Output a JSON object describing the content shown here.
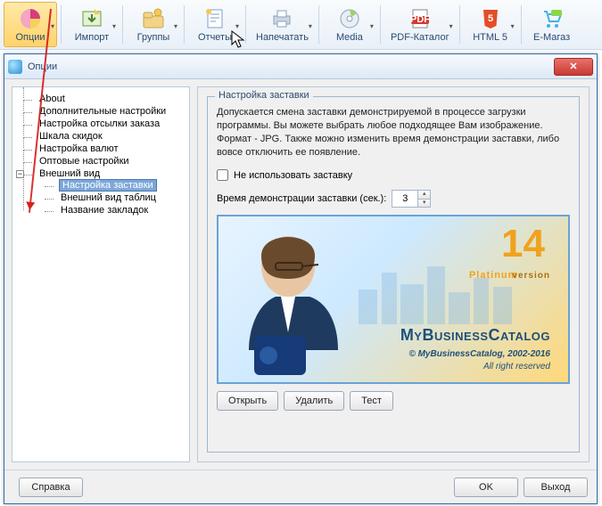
{
  "toolbar": {
    "items": [
      {
        "label": "Опции"
      },
      {
        "label": "Импорт"
      },
      {
        "label": "Группы"
      },
      {
        "label": "Отчеты"
      },
      {
        "label": "Напечатать"
      },
      {
        "label": "Media"
      },
      {
        "label": "PDF-Каталог"
      },
      {
        "label": "HTML 5"
      },
      {
        "label": "E-Магаз"
      }
    ]
  },
  "dialog": {
    "title": "Опции",
    "close": "✕"
  },
  "tree": {
    "items": [
      "About",
      "Дополнительные настройки",
      "Настройка отсылки заказа",
      "Шкала скидок",
      "Настройка валют",
      "Оптовые настройки"
    ],
    "group_label": "Внешний вид",
    "group_expander": "−",
    "children": [
      "Настройка заставки",
      "Внешний вид таблиц",
      "Название закладок"
    ]
  },
  "panel": {
    "legend": "Настройка заставки",
    "description": "Допускается смена заставки демонстрируемой в процессе загрузки программы. Вы можете выбрать любое подходящее Вам изображение. Формат - JPG. Также можно изменить время демонстрации заставки, либо вовсе отключить ее появление.",
    "disable_label": "Не использовать заставку",
    "time_label": "Время демонстрации заставки (сек.):",
    "time_value": "3",
    "splash": {
      "version": "14",
      "edition": "Platinum",
      "edition_sub": "version",
      "brand": "MyBusinessCatalog",
      "copyright": "© MyBusinessCatalog, 2002-2016",
      "rights": "All right reserved"
    },
    "open_btn": "Открыть",
    "delete_btn": "Удалить",
    "test_btn": "Тест"
  },
  "footer": {
    "help": "Справка",
    "ok": "OK",
    "exit": "Выход"
  }
}
